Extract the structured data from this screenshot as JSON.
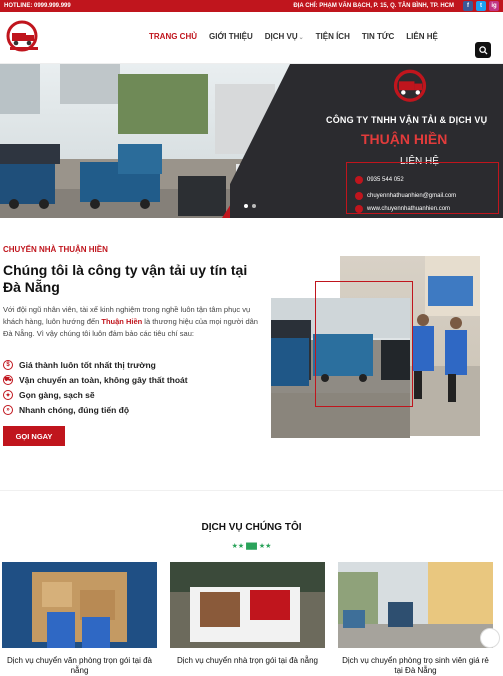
{
  "topbar": {
    "hotline": "HOTLINE: 0999.999.999",
    "address": "ĐỊA CHỈ: PHẠM VĂN BẠCH, P. 15, Q. TÂN BÌNH, TP. HCM",
    "social": [
      "f",
      "t",
      "ig"
    ]
  },
  "nav": {
    "items": [
      "TRANG CHỦ",
      "GIỚI THIỆU",
      "DỊCH VỤ",
      "TIỆN ÍCH",
      "TIN TỨC",
      "LIÊN HỆ"
    ],
    "active": "TRANG CHỦ"
  },
  "banner": {
    "company": "CÔNG TY TNHH VẬN TẢI & DỊCH VỤ",
    "brand": "THUẬN HIỀN",
    "contact_label": "LIÊN HỆ",
    "phone": "0935 544 052",
    "email": "chuyennhathuanhien@gmail.com",
    "website": "www.chuyennhathuanhien.com"
  },
  "about": {
    "kicker": "CHUYỂN NHÀ THUẬN HIỀN",
    "title": "Chúng tôi là công ty vận tải uy tín tại Đà Nẵng",
    "text_before": "Với đội ngũ nhân viên, tài xế kinh nghiệm trong nghề luôn tận tâm phục vụ khách hàng, luôn hướng đến ",
    "text_brand": "Thuận Hiền",
    "text_after": " là thương hiệu của mọi người dân Đà Nẵng. Vì vậy chúng tôi luôn đảm bảo các tiêu chí sau:",
    "features": [
      "Giá thành luôn tốt nhất thị trường",
      "Vận chuyển an toàn, không gây thất thoát",
      "Gọn gàng, sạch sẽ",
      "Nhanh chóng, đúng tiến độ"
    ],
    "cta": "GỌI NGAY"
  },
  "services": {
    "title": "DỊCH VỤ CHÚNG TÔI",
    "cards": [
      "Dịch vụ chuyển văn phòng trọn gói tại đà nẵng",
      "Dịch vụ chuyển nhà trọn gói tại đà nẵng",
      "Dịch vụ chuyển phòng trọ sinh viên giá rẻ tại Đà Nẵng"
    ]
  },
  "colors": {
    "brand_red": "#c0151d",
    "accent_green": "#2aa35a"
  }
}
